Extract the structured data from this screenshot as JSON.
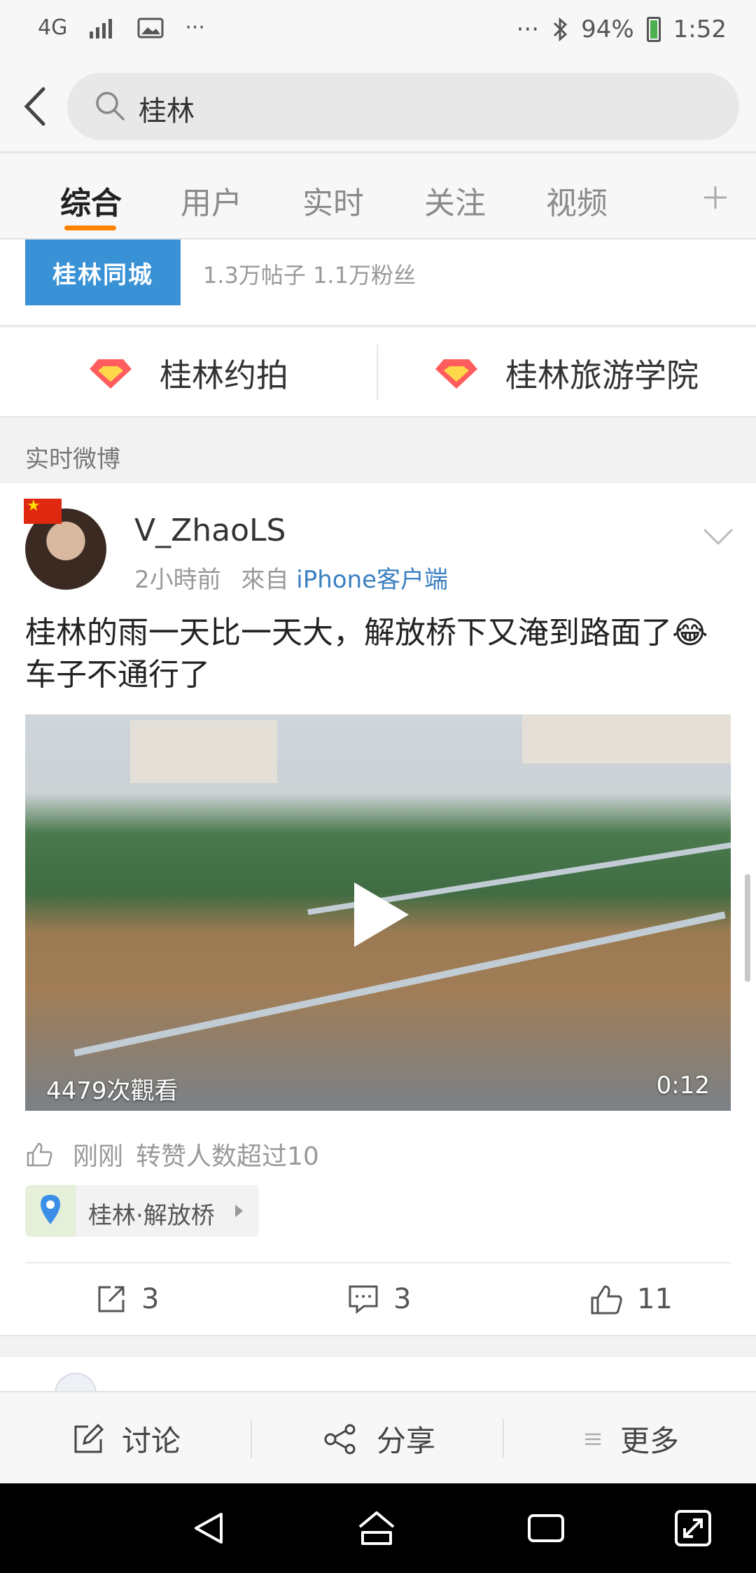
{
  "status_bar": {
    "network": "4G",
    "more_left": "···",
    "more_right": "···",
    "battery": "94%",
    "time": "1:52"
  },
  "search": {
    "query": "桂林"
  },
  "tabs": [
    "综合",
    "用户",
    "实时",
    "关注",
    "视频"
  ],
  "active_tab": 0,
  "group_card": {
    "logo_text": "桂林同城",
    "meta": "1.3万帖子 1.1万粉丝"
  },
  "topics": [
    {
      "label": "桂林约拍"
    },
    {
      "label": "桂林旅游学院"
    }
  ],
  "section_title": "实时微博",
  "post": {
    "user": "V_ZhaoLS",
    "time": "2小時前",
    "via": "來自",
    "source": "iPhone客户端",
    "text_line1": "桂林的雨一天比一天大，解放桥下又淹到路面了😂",
    "text_line2": "车子不通行了",
    "video_views": "4479次觀看",
    "video_duration": "0:12",
    "like_note_time": "刚刚",
    "like_note": "转赞人数超过10",
    "location": "桂林·解放桥",
    "reposts": "3",
    "comments": "3",
    "likes": "11"
  },
  "bottom_bar": {
    "discuss": "讨论",
    "share": "分享",
    "more": "更多"
  },
  "colors": {
    "accent": "#ff8200",
    "link": "#3a7fc1"
  }
}
